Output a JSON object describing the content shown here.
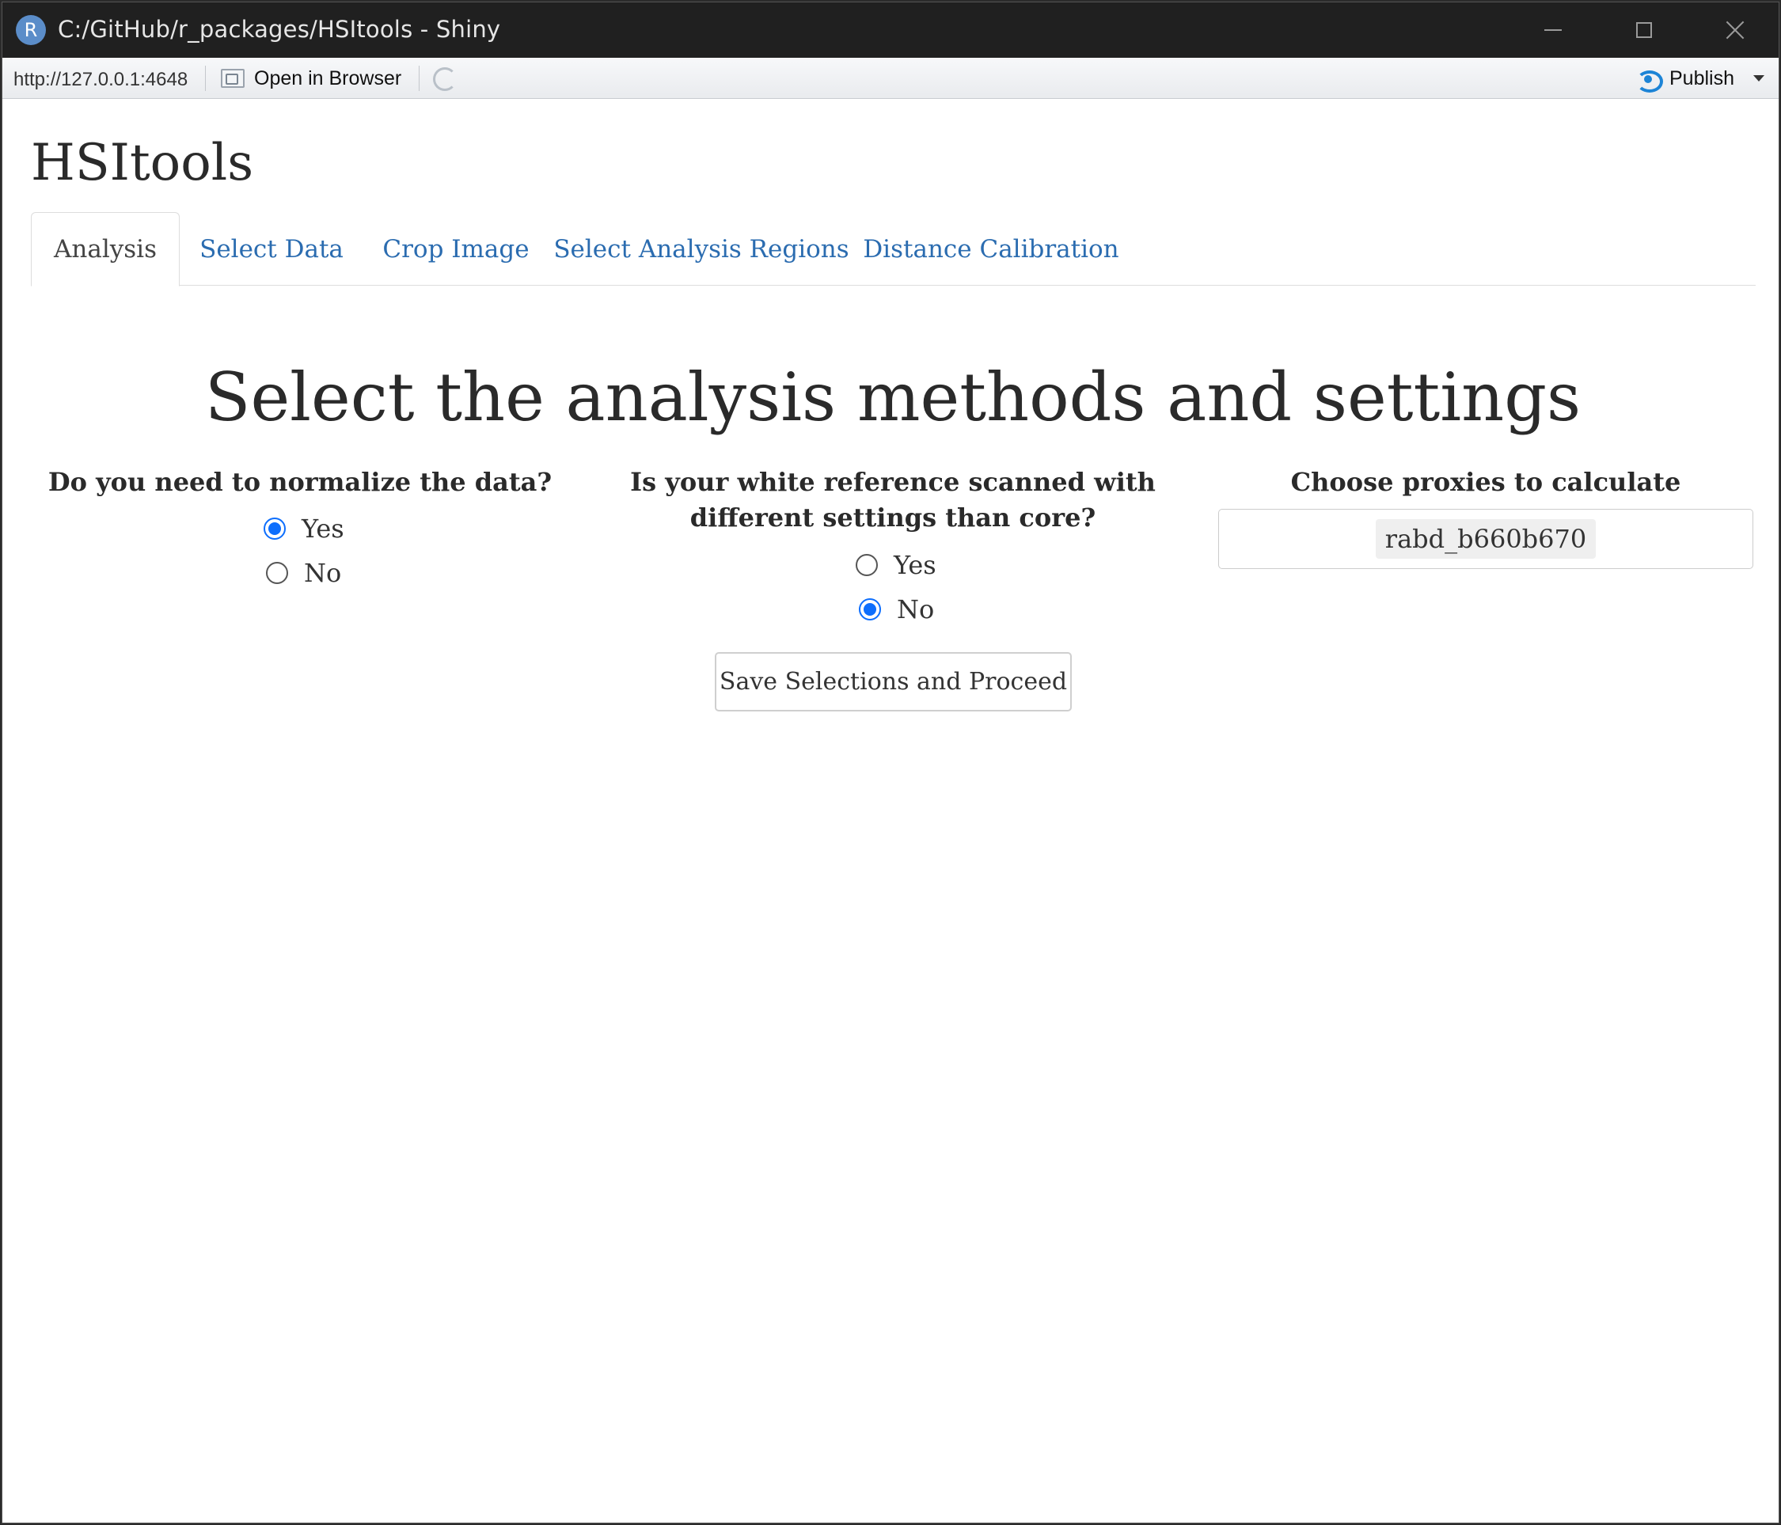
{
  "window": {
    "title": "C:/GitHub/r_packages/HSItools - Shiny",
    "logo_letter": "R"
  },
  "toolbar": {
    "url": "http://127.0.0.1:4648",
    "open_in_browser": "Open in Browser",
    "publish": "Publish"
  },
  "app": {
    "title": "HSItools",
    "tabs": [
      {
        "label": "Analysis",
        "active": true
      },
      {
        "label": "Select Data",
        "active": false
      },
      {
        "label": "Crop Image",
        "active": false
      },
      {
        "label": "Select Analysis Regions",
        "active": false
      },
      {
        "label": "Distance Calibration",
        "active": false
      }
    ],
    "heading": "Select the analysis methods and settings",
    "normalize": {
      "question": "Do you need to normalize the data?",
      "options": [
        "Yes",
        "No"
      ],
      "selected": "Yes"
    },
    "white_reference": {
      "question": "Is your white reference scanned with different settings than core?",
      "options": [
        "Yes",
        "No"
      ],
      "selected": "No"
    },
    "proxies": {
      "label": "Choose proxies to calculate",
      "selected": [
        "rabd_b660b670"
      ]
    },
    "save_button": "Save Selections and Proceed"
  },
  "colors": {
    "accent": "#0d6efd",
    "tab_link": "#2b6cb0",
    "titlebar": "#202020"
  }
}
